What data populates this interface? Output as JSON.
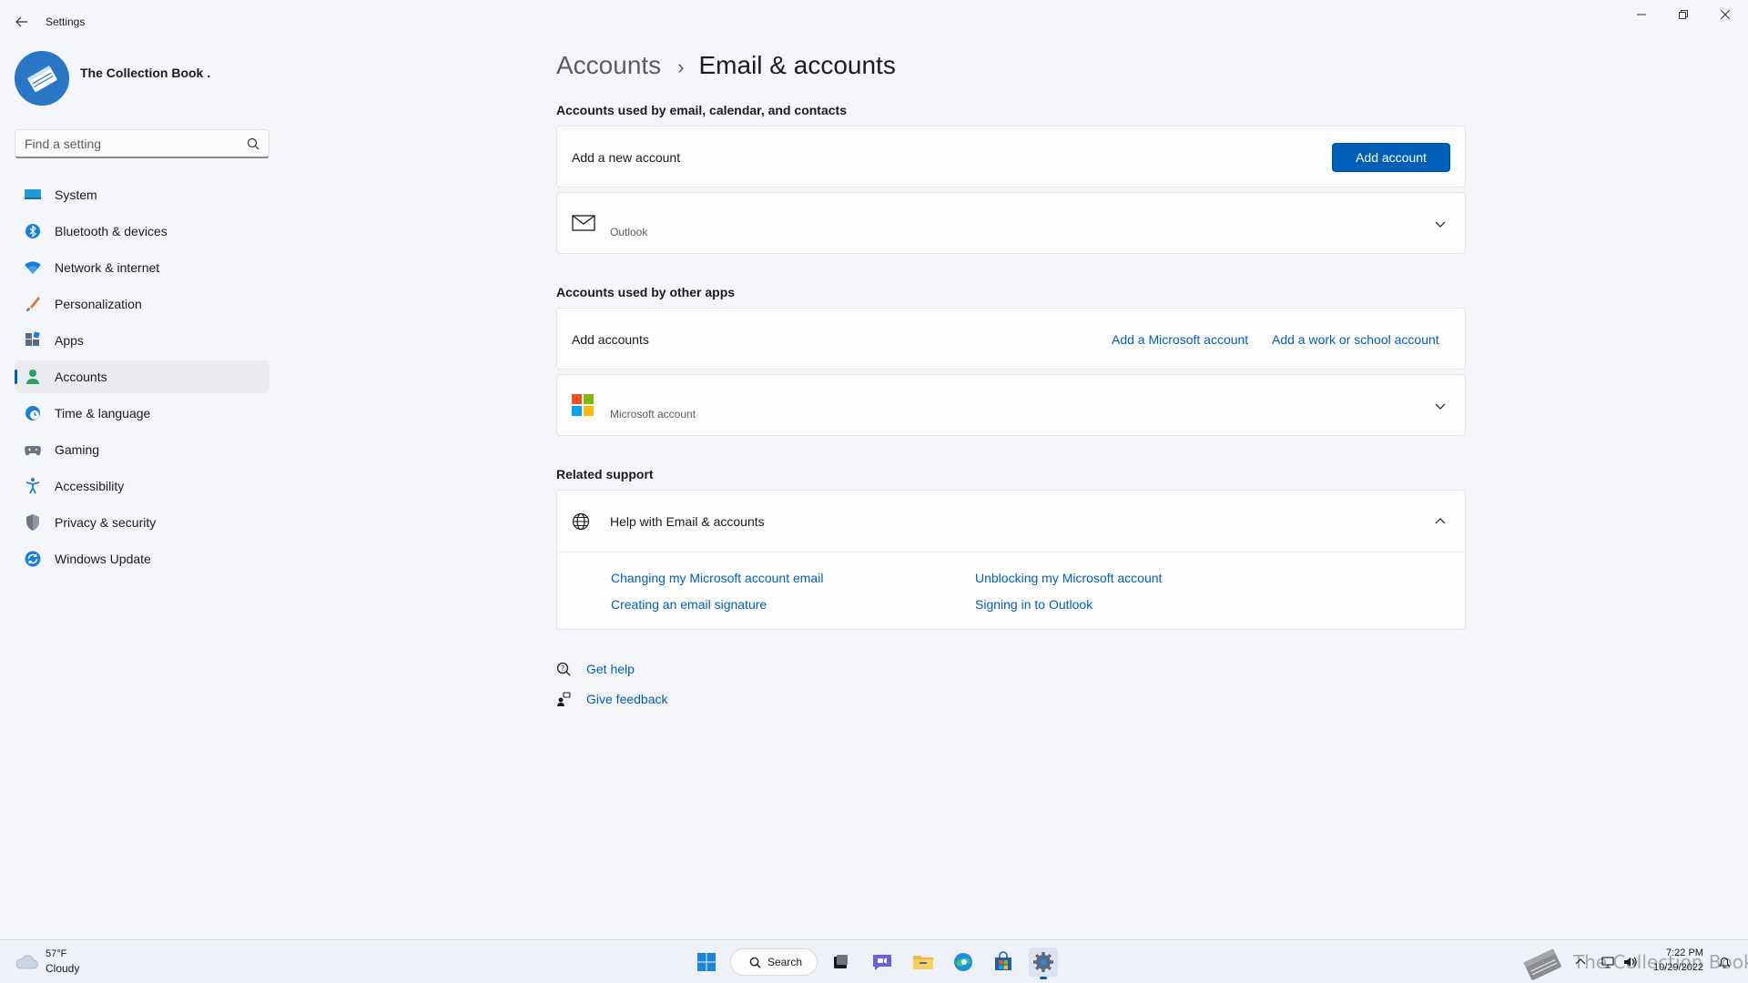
{
  "window": {
    "title": "Settings",
    "controls": {
      "minimize": "—",
      "restore": "❐",
      "close": "✕"
    }
  },
  "profile": {
    "name": "The Collection Book ."
  },
  "search": {
    "placeholder": "Find a setting"
  },
  "sidebar": {
    "items": [
      {
        "label": "System",
        "icon": "system-icon"
      },
      {
        "label": "Bluetooth & devices",
        "icon": "bluetooth-icon"
      },
      {
        "label": "Network & internet",
        "icon": "wifi-icon"
      },
      {
        "label": "Personalization",
        "icon": "brush-icon"
      },
      {
        "label": "Apps",
        "icon": "apps-icon"
      },
      {
        "label": "Accounts",
        "icon": "person-icon",
        "active": true
      },
      {
        "label": "Time & language",
        "icon": "globe-clock-icon"
      },
      {
        "label": "Gaming",
        "icon": "gamepad-icon"
      },
      {
        "label": "Accessibility",
        "icon": "accessibility-icon"
      },
      {
        "label": "Privacy & security",
        "icon": "shield-icon"
      },
      {
        "label": "Windows Update",
        "icon": "update-icon"
      }
    ]
  },
  "breadcrumb": {
    "parent": "Accounts",
    "separator": "›",
    "current": "Email & accounts"
  },
  "email_section": {
    "title": "Accounts used by email, calendar, and contacts",
    "add_row": {
      "label": "Add a new account",
      "button": "Add account"
    },
    "outlook": {
      "sublabel": "Outlook"
    }
  },
  "other_apps": {
    "title": "Accounts used by other apps",
    "add_row": {
      "label": "Add accounts",
      "link_ms": "Add a Microsoft account",
      "link_work": "Add a work or school account"
    },
    "ms_account": {
      "sublabel": "Microsoft account"
    }
  },
  "support": {
    "title": "Related support",
    "help": {
      "label": "Help with Email & accounts",
      "links": [
        "Changing my Microsoft account email",
        "Unblocking my Microsoft account",
        "Creating an email signature",
        "Signing in to Outlook"
      ]
    }
  },
  "footer": {
    "get_help": "Get help",
    "give_feedback": "Give feedback"
  },
  "taskbar": {
    "weather": {
      "temp": "57°F",
      "condition": "Cloudy"
    },
    "search_label": "Search",
    "clock": {
      "time": "7:22 PM",
      "date": "10/29/2022"
    },
    "watermark": "The Collection Book"
  },
  "colors": {
    "accent": "#005fb8",
    "background": "#f5f6f9",
    "card": "#fdfdfd",
    "taskbar": "#eef1f8"
  }
}
